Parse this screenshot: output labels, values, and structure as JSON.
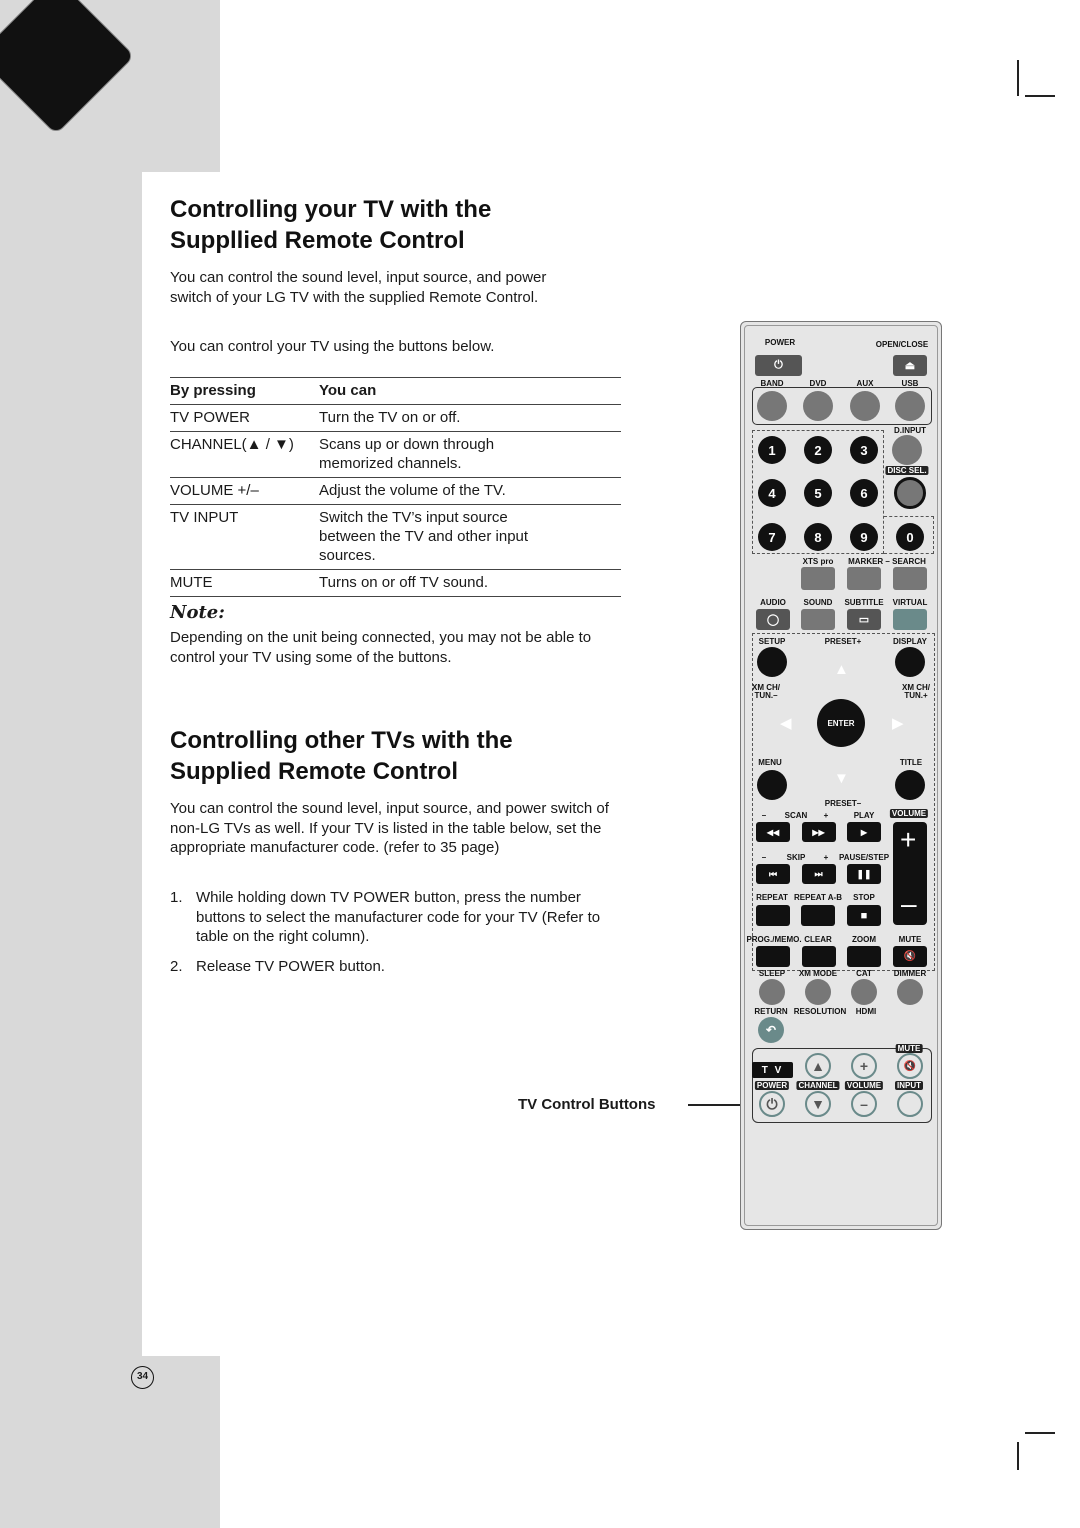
{
  "section1": {
    "title_line1": "Controlling your TV with the",
    "title_line2": "Suppllied Remote Control",
    "para1_line1": "You can control the sound level, input source, and power",
    "para1_line2": "switch of your LG TV with the supplied Remote Control.",
    "para2": "You can control your TV using the buttons below."
  },
  "table": {
    "headers": [
      "By pressing",
      "You can"
    ],
    "rows": [
      {
        "key": "TV POWER",
        "value": "Turn the TV on or off."
      },
      {
        "key": "CHANNEL(▲ / ▼)",
        "value": "Scans up or down through memorized channels."
      },
      {
        "key": "VOLUME +/–",
        "value": "Adjust the volume of the TV."
      },
      {
        "key": "TV INPUT",
        "value": "Switch the TV’s input source between the TV and other input sources."
      },
      {
        "key": "MUTE",
        "value": "Turns on or off TV sound."
      }
    ]
  },
  "note": {
    "heading": "Note:",
    "text": "Depending on the unit being connected, you may not be able to control your TV using some of the buttons."
  },
  "section2": {
    "title_line1": "Controlling other TVs with the",
    "title_line2": "Supplied Remote Control",
    "para": "You can control the sound level, input source, and power switch of non-LG TVs as well. If your TV is listed in the table below, set the appropriate manufacturer code. (refer to 35 page)",
    "steps": [
      {
        "num": "1.",
        "text": "While holding down TV POWER button, press the number buttons to select the manufacturer code for your TV (Refer to table on the right column)."
      },
      {
        "num": "2.",
        "text": "Release TV POWER button."
      }
    ]
  },
  "tv_control_caption": "TV Control Buttons",
  "page_number": "34",
  "remote": {
    "labels": [
      "POWER",
      "OPEN/CLOSE",
      "BAND",
      "DVD",
      "AUX",
      "USB",
      "D.INPUT",
      "DISC SEL.",
      "XTS pro",
      "MARKER – SEARCH",
      "AUDIO",
      "SOUND",
      "SUBTITLE",
      "VIRTUAL",
      "SETUP",
      "PRESET+",
      "DISPLAY",
      "XM CH/",
      "TUN.–",
      "XM CH/",
      "TUN.+",
      "MENU",
      "TITLE",
      "PRESET–",
      "–",
      "SCAN",
      "+",
      "PLAY",
      "VOLUME",
      "–",
      "SKIP",
      "+",
      "PAUSE/STEP",
      "REPEAT",
      "REPEAT A-B",
      "STOP",
      "PROG./MEMO.",
      "CLEAR",
      "ZOOM",
      "MUTE",
      "SLEEP",
      "XM MODE",
      "CAT",
      "DIMMER",
      "RETURN",
      "RESOLUTION",
      "HDMI",
      "MUTE",
      "POWER",
      "CHANNEL",
      "VOLUME",
      "INPUT"
    ],
    "digits": [
      "1",
      "2",
      "3",
      "4",
      "5",
      "6",
      "7",
      "8",
      "9",
      "0"
    ],
    "enter": "ENTER",
    "tv": "T V",
    "colors": {
      "dark": "#111111",
      "gray": "#777777",
      "teal": "#6a8a8a",
      "body": "#e6e6e6"
    }
  }
}
